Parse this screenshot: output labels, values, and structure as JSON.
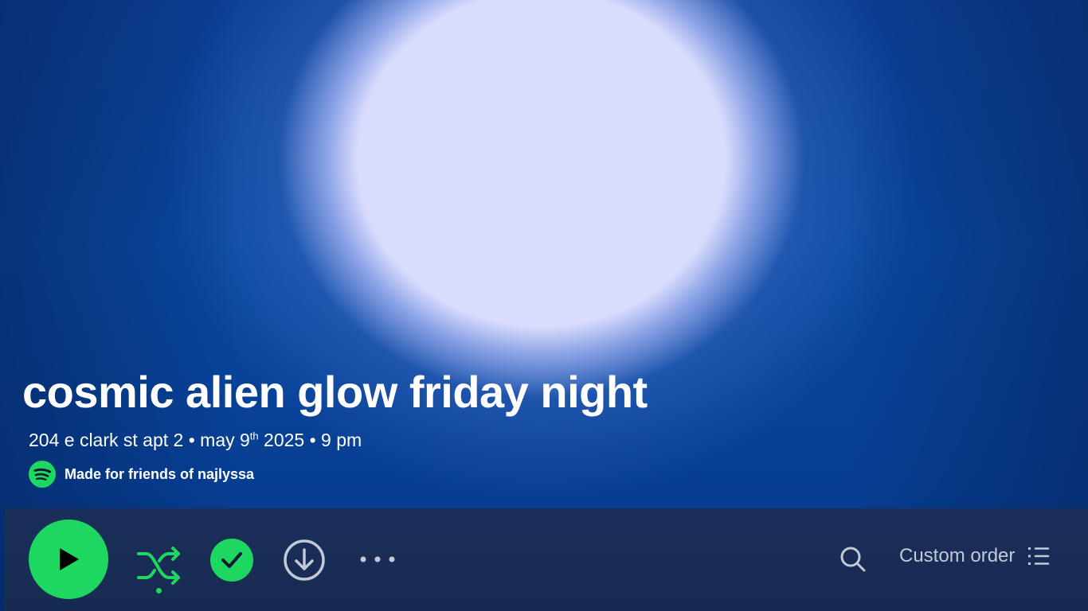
{
  "playlist": {
    "title": "cosmic alien glow friday night",
    "details_prefix": "204 e clark st apt 2 • may 9",
    "details_sup": "th",
    "details_suffix": " 2025 • 9 pm",
    "made_for": "Made for friends of najlyssa"
  },
  "actions": {
    "play_icon": "play-icon",
    "shuffle_icon": "shuffle-icon",
    "saved_icon": "check-icon",
    "download_icon": "download-icon",
    "more_icon": "more-icon"
  },
  "toolbar": {
    "search_icon": "search-icon",
    "sort_label": "Custom order",
    "sort_icon": "list-icon"
  },
  "colors": {
    "accent": "#1ed760",
    "bar_background": "#182b53",
    "hero_glow": "#d9dcfd",
    "hero_blue": "#0a48a0"
  }
}
